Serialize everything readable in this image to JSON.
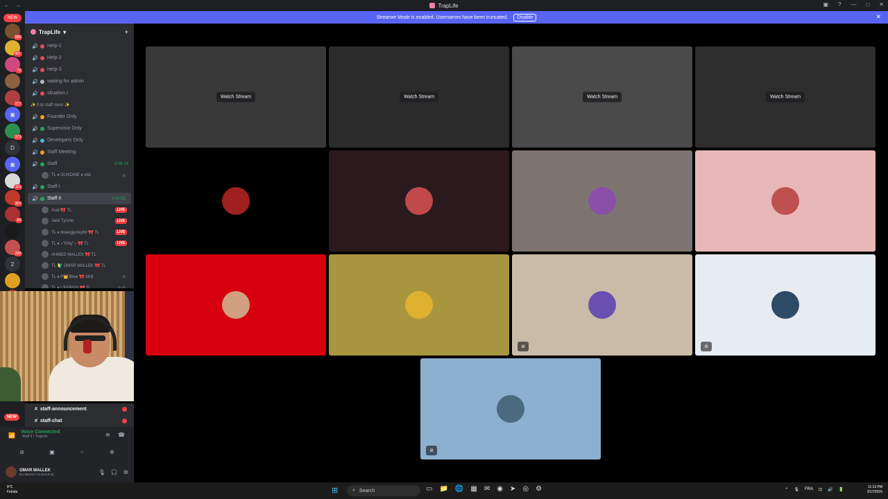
{
  "window": {
    "title": "TrapLife",
    "nav_back": "←",
    "nav_fwd": "→",
    "ctl_min": "—",
    "ctl_max": "□",
    "ctl_close": "✕",
    "inbox": "▣",
    "help": "?"
  },
  "banner": {
    "text": "Streamer Mode is enabled. Usernames have been truncated.",
    "button": "Disable",
    "close": "✕"
  },
  "guilds": [
    {
      "label": "NEW",
      "badge": "",
      "color": "#f23f43",
      "new": true
    },
    {
      "label": "",
      "badge": "588",
      "color": "#7a5230"
    },
    {
      "label": "",
      "badge": "481",
      "color": "#e0b030"
    },
    {
      "label": "",
      "badge": "79",
      "color": "#d04880"
    },
    {
      "label": "",
      "badge": "",
      "color": "#8a6040"
    },
    {
      "label": "",
      "badge": "217",
      "color": "#b04040"
    },
    {
      "label": "▣",
      "badge": "",
      "color": "#5865f2"
    },
    {
      "label": "",
      "badge": "373",
      "color": "#2f8f4f"
    },
    {
      "label": "D",
      "badge": "",
      "color": "#313338"
    },
    {
      "label": "▣",
      "badge": "",
      "color": "#5865f2"
    },
    {
      "label": "",
      "badge": "116",
      "color": "#d9d9d9"
    },
    {
      "label": "",
      "badge": "304",
      "color": "#c0392b"
    },
    {
      "label": "",
      "badge": "84",
      "color": "#a83232"
    },
    {
      "label": "",
      "badge": "",
      "color": "#1a1a1a"
    },
    {
      "label": "",
      "badge": "288",
      "color": "#c45050"
    },
    {
      "label": "2",
      "badge": "",
      "color": "#313338"
    },
    {
      "label": "",
      "badge": "",
      "color": "#e0a020"
    },
    {
      "label": "",
      "badge": "",
      "color": "#c03030"
    }
  ],
  "server": {
    "name": "TrapLife",
    "chevron": "▾",
    "add_icon": "+"
  },
  "channels": [
    {
      "name": "Help-1",
      "emoji": "#e84a5f",
      "type": "voice"
    },
    {
      "name": "Help-2",
      "emoji": "#e84a5f",
      "type": "voice"
    },
    {
      "name": "Help-3",
      "emoji": "#e84a5f",
      "type": "voice"
    },
    {
      "name": "waiting for admin",
      "emoji": "#b5bac1",
      "type": "voice"
    },
    {
      "name": "situation I",
      "emoji": "#e84a5f",
      "type": "voice"
    },
    {
      "name": "✨ tl rp staff room ✨",
      "type": "category"
    },
    {
      "name": "Founder Only",
      "emoji": "#f0a030",
      "type": "voice"
    },
    {
      "name": "Supervisor Only",
      "emoji": "#23a55a",
      "type": "voice"
    },
    {
      "name": "Developers Only",
      "emoji": "#4fb4e8",
      "type": "voice"
    },
    {
      "name": "Staff Meeting",
      "emoji": "#f0a030",
      "type": "voice"
    },
    {
      "name": "Staff",
      "emoji": "#23a55a",
      "type": "voice",
      "timer": "9:06:19"
    },
    {
      "name": "TL ♦ GUNDINE ♦ ɢ4ᴇ",
      "type": "user",
      "muted": "⊘"
    },
    {
      "name": "Staff I",
      "emoji": "#23a55a",
      "type": "voice"
    },
    {
      "name": "Staff II",
      "emoji": "#23a55a",
      "type": "voice",
      "timer": "4:34:51",
      "active": true
    },
    {
      "name": "Asal 🎀 TL",
      "type": "user",
      "live": "LIVE"
    },
    {
      "name": "Jack Tyrone",
      "type": "user",
      "live": "LIVE"
    },
    {
      "name": "TL ♦ doawgjunky69 🎀 TL",
      "type": "user",
      "live": "LIVE"
    },
    {
      "name": "TL ♦ ⋆˚Kitty˚⋆ 🎀 TL",
      "type": "user",
      "live": "LIVE"
    },
    {
      "name": "AHMED MALLEK 🎀 TL",
      "type": "user"
    },
    {
      "name": "TL 🔰 OMAR MALLEK 🎀 TL",
      "type": "user"
    },
    {
      "name": "TL ♦ P👑3llwa 🎀 AK$",
      "type": "user",
      "muted": "⊘"
    },
    {
      "name": "TL ♦ L'FERSSI 🎀 TL",
      "type": "user",
      "muted": "⊘ ⊘"
    }
  ],
  "text_channels": [
    {
      "name": "staff-announcement"
    },
    {
      "name": "staff-chat"
    }
  ],
  "new_badge": "NEW",
  "voice": {
    "status": "Voice Connected",
    "location": "Staff II / TrapLife",
    "signal_icon": "📶",
    "wave_icon": "≋",
    "hangup_icon": "☎",
    "btn_video": "⊘",
    "btn_share": "▣",
    "btn_activity": "⁘",
    "btn_sound": "✲"
  },
  "user": {
    "name": "OMAR MALLEK",
    "status": "ELI BEJNA YJI NHAR W",
    "mic": "🎙",
    "headset": "🎧",
    "settings": "⚙"
  },
  "tiles": [
    {
      "kind": "stream",
      "button": "Watch Stream",
      "bg": "#3a3a3a"
    },
    {
      "kind": "stream",
      "button": "Watch Stream",
      "bg": "#2b2b2b"
    },
    {
      "kind": "stream",
      "button": "Watch Stream",
      "bg": "#4a4a4a"
    },
    {
      "kind": "stream",
      "button": "Watch Stream",
      "bg": "#2e2e2e"
    },
    {
      "kind": "avatar",
      "bg": "#000000",
      "avatar": "#a02020",
      "mic": ""
    },
    {
      "kind": "avatar",
      "bg": "#2a1a1e",
      "avatar": "#c04a4a",
      "mic": ""
    },
    {
      "kind": "avatar",
      "bg": "#7d7472",
      "avatar": "#8a4fa8",
      "mic": ""
    },
    {
      "kind": "avatar",
      "bg": "#e8b7b7",
      "avatar": "#c05050",
      "mic": ""
    },
    {
      "kind": "avatar",
      "bg": "#d8000e",
      "avatar": "#d0a080",
      "mic": ""
    },
    {
      "kind": "avatar",
      "bg": "#a8963f",
      "avatar": "#e0b030",
      "mic": ""
    },
    {
      "kind": "avatar",
      "bg": "#c9bba8",
      "avatar": "#6a4fb0",
      "mic": "⊘"
    },
    {
      "kind": "avatar",
      "bg": "#e7ebf2",
      "avatar": "#2d4a66",
      "mic": "⊘"
    },
    {
      "kind": "avatar",
      "bg": "#8cb0d0",
      "avatar": "#4a6a80",
      "mic": "⊘"
    }
  ],
  "taskbar": {
    "weather_temp": "8°C",
    "weather_desc": "Febida",
    "start_icon": "⊞",
    "search_icon": "⌕",
    "search": "Search",
    "apps": [
      "▭",
      "📁",
      "🌐",
      "▦",
      "✉",
      "◉",
      "➤",
      "◎",
      "⚙"
    ],
    "tray": [
      "⌃",
      "🎙",
      "FRA",
      "⊡",
      "🔊",
      "🔋"
    ],
    "time": "11:13 PM",
    "date": "3/17/2026"
  }
}
